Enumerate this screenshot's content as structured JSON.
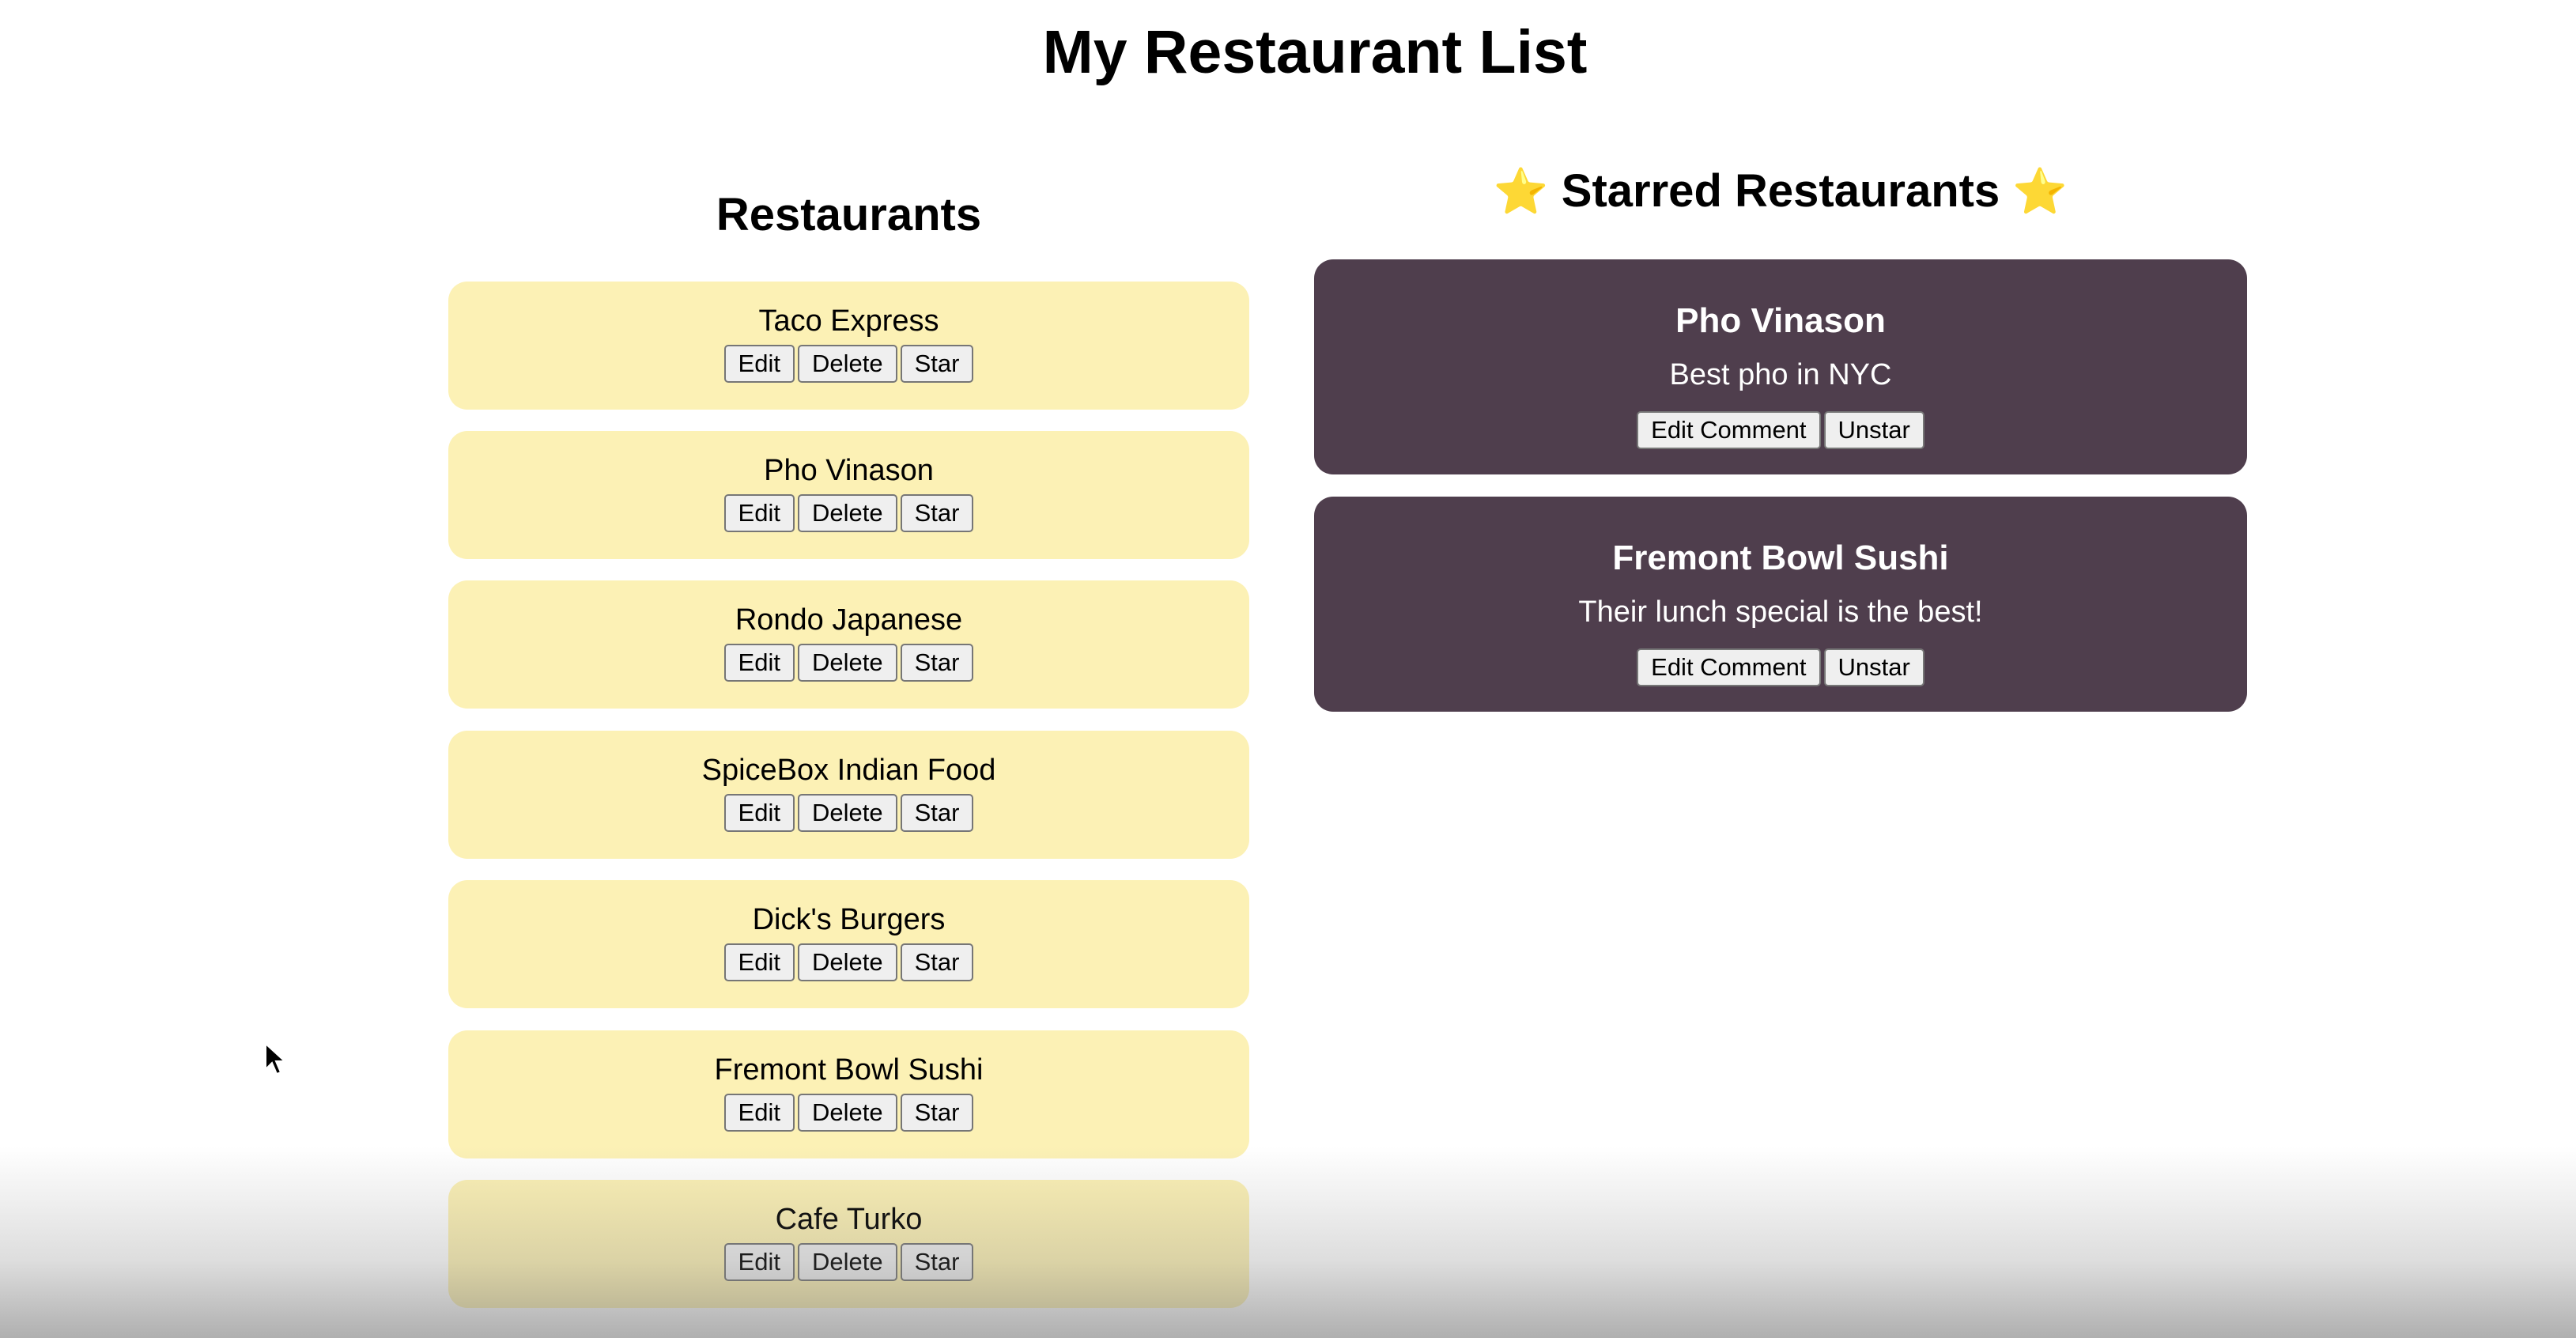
{
  "page": {
    "title": "My Restaurant List"
  },
  "restaurants_section": {
    "title": "Restaurants",
    "items": [
      {
        "name": "Taco Express"
      },
      {
        "name": "Pho Vinason"
      },
      {
        "name": "Rondo Japanese"
      },
      {
        "name": "SpiceBox Indian Food"
      },
      {
        "name": "Dick's Burgers"
      },
      {
        "name": "Fremont Bowl Sushi"
      },
      {
        "name": "Cafe Turko"
      }
    ],
    "buttons": {
      "edit": "Edit",
      "delete": "Delete",
      "star": "Star"
    }
  },
  "starred_section": {
    "title": "Starred Restaurants",
    "emoji": "⭐",
    "items": [
      {
        "name": "Pho Vinason",
        "comment": "Best pho in NYC"
      },
      {
        "name": "Fremont Bowl Sushi",
        "comment": "Their lunch special is the best!"
      }
    ],
    "buttons": {
      "edit_comment": "Edit Comment",
      "unstar": "Unstar"
    }
  },
  "colors": {
    "card_background": "#fcf1b5",
    "starred_card_background": "#4f3e4d",
    "starred_text": "#ffffff",
    "star_icon": "#f5b800"
  }
}
